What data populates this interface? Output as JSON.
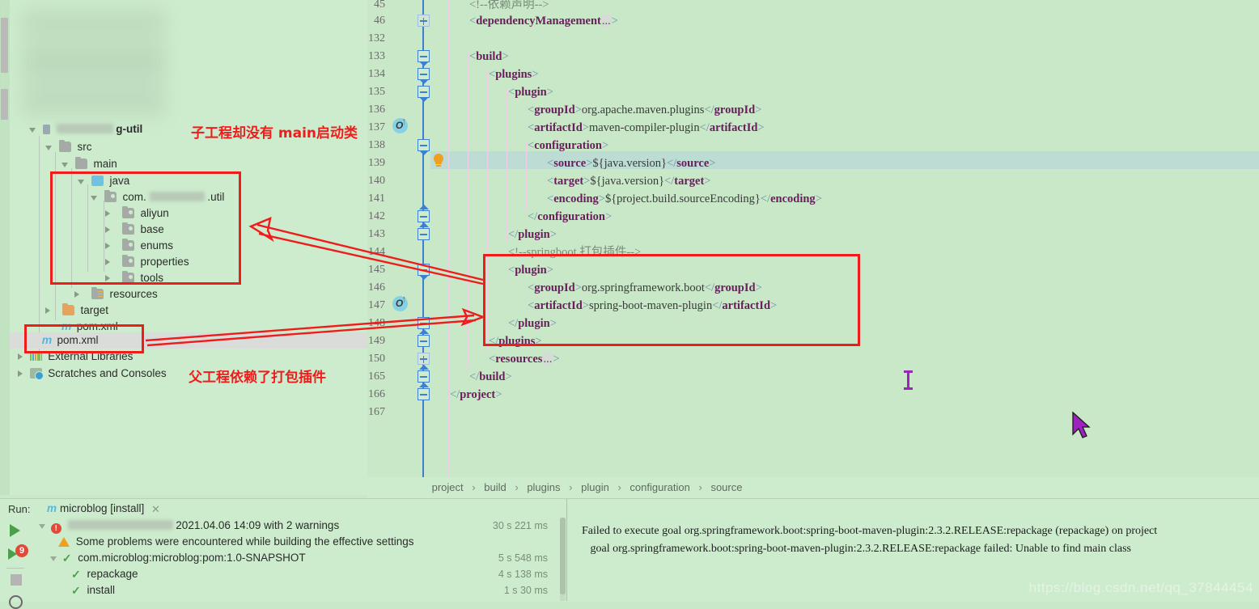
{
  "annotations": {
    "top_note": "子工程却没有 main启动类",
    "bottom_note": "父工程依赖了打包插件",
    "color": "#ef1c1c"
  },
  "project_tree": {
    "items": [
      {
        "label": "g-util",
        "type": "module",
        "icon": "module-icon",
        "blurred_prefix": true,
        "depth": 0,
        "expanded": true,
        "bold": true
      },
      {
        "label": "src",
        "type": "folder",
        "icon": "folder-icon",
        "depth": 1,
        "expanded": true
      },
      {
        "label": "main",
        "type": "folder",
        "icon": "folder-icon",
        "depth": 2,
        "expanded": true
      },
      {
        "label": "java",
        "type": "source-root",
        "icon": "source-root-icon",
        "depth": 3,
        "expanded": true
      },
      {
        "label": "com.",
        "label_suffix": ".util",
        "type": "package",
        "icon": "package-icon",
        "depth": 4,
        "expanded": true,
        "blurred_middle": true
      },
      {
        "label": "aliyun",
        "type": "package",
        "icon": "package-icon",
        "depth": 5,
        "expanded": false
      },
      {
        "label": "base",
        "type": "package",
        "icon": "package-icon",
        "depth": 5,
        "expanded": false
      },
      {
        "label": "enums",
        "type": "package",
        "icon": "package-icon",
        "depth": 5,
        "expanded": false
      },
      {
        "label": "properties",
        "type": "package",
        "icon": "package-icon",
        "depth": 5,
        "expanded": false
      },
      {
        "label": "tools",
        "type": "package",
        "icon": "package-icon",
        "depth": 5,
        "expanded": false
      },
      {
        "label": "resources",
        "type": "resources-root",
        "icon": "resources-icon",
        "depth": 3,
        "expanded": false
      },
      {
        "label": "target",
        "type": "folder",
        "icon": "folder-orange-icon",
        "depth": 2,
        "expanded": false
      },
      {
        "label": "pom.xml",
        "type": "file",
        "icon": "maven-icon",
        "depth": 2
      },
      {
        "label": "pom.xml",
        "type": "file",
        "icon": "maven-icon",
        "depth": 1,
        "selected": true
      },
      {
        "label": "External Libraries",
        "type": "node",
        "icon": "libraries-icon",
        "depth": 0,
        "expanded": false
      },
      {
        "label": "Scratches and Consoles",
        "type": "node",
        "icon": "scratches-icon",
        "depth": 0,
        "expanded": false
      }
    ]
  },
  "editor": {
    "lines": [
      {
        "num": "45",
        "indent": 2,
        "segments": [
          {
            "t": "<!--依赖声明-->",
            "c": "cm"
          }
        ]
      },
      {
        "num": "46",
        "indent": 2,
        "fold": "plus",
        "segments": [
          {
            "t": "<",
            "c": "br"
          },
          {
            "t": "dependencyManagement",
            "c": "tg"
          },
          {
            "t": "...",
            "c": "ph"
          },
          {
            "t": ">",
            "c": "br"
          }
        ]
      },
      {
        "num": "132",
        "indent": 0,
        "segments": []
      },
      {
        "num": "133",
        "indent": 2,
        "fold": "minus",
        "segments": [
          {
            "t": "<",
            "c": "br"
          },
          {
            "t": "build",
            "c": "tg"
          },
          {
            "t": ">",
            "c": "br"
          }
        ]
      },
      {
        "num": "134",
        "indent": 4,
        "fold": "minus",
        "segments": [
          {
            "t": "<",
            "c": "br"
          },
          {
            "t": "plugins",
            "c": "tg"
          },
          {
            "t": ">",
            "c": "br"
          }
        ]
      },
      {
        "num": "135",
        "indent": 6,
        "fold": "minus",
        "segments": [
          {
            "t": "<",
            "c": "br"
          },
          {
            "t": "plugin",
            "c": "tg"
          },
          {
            "t": ">",
            "c": "br"
          }
        ]
      },
      {
        "num": "136",
        "indent": 8,
        "segments": [
          {
            "t": "<",
            "c": "br"
          },
          {
            "t": "groupId",
            "c": "tg"
          },
          {
            "t": ">",
            "c": "br"
          },
          {
            "t": "org.apache.maven.plugins",
            "c": "v"
          },
          {
            "t": "</",
            "c": "br"
          },
          {
            "t": "groupId",
            "c": "tg"
          },
          {
            "t": ">",
            "c": "br"
          }
        ]
      },
      {
        "num": "137",
        "indent": 8,
        "overrides": true,
        "segments": [
          {
            "t": "<",
            "c": "br"
          },
          {
            "t": "artifactId",
            "c": "tg"
          },
          {
            "t": ">",
            "c": "br"
          },
          {
            "t": "maven-compiler-plugin",
            "c": "v"
          },
          {
            "t": "</",
            "c": "br"
          },
          {
            "t": "artifactId",
            "c": "tg"
          },
          {
            "t": ">",
            "c": "br"
          }
        ]
      },
      {
        "num": "138",
        "indent": 8,
        "fold": "minus",
        "segments": [
          {
            "t": "<",
            "c": "br"
          },
          {
            "t": "configuration",
            "c": "tg"
          },
          {
            "t": ">",
            "c": "br"
          }
        ]
      },
      {
        "num": "139",
        "indent": 10,
        "highlight": true,
        "bulb": true,
        "segments": [
          {
            "t": "<",
            "c": "br"
          },
          {
            "t": "source",
            "c": "tg"
          },
          {
            "t": ">",
            "c": "br"
          },
          {
            "t": "${java.version}",
            "c": "v"
          },
          {
            "t": "</",
            "c": "br"
          },
          {
            "t": "source",
            "c": "tg"
          },
          {
            "t": ">",
            "c": "br"
          }
        ]
      },
      {
        "num": "140",
        "indent": 10,
        "segments": [
          {
            "t": "<",
            "c": "br"
          },
          {
            "t": "target",
            "c": "tg"
          },
          {
            "t": ">",
            "c": "br"
          },
          {
            "t": "${java.version}",
            "c": "v"
          },
          {
            "t": "</",
            "c": "br"
          },
          {
            "t": "target",
            "c": "tg"
          },
          {
            "t": ">",
            "c": "br"
          }
        ]
      },
      {
        "num": "141",
        "indent": 10,
        "segments": [
          {
            "t": "<",
            "c": "br"
          },
          {
            "t": "encoding",
            "c": "tg"
          },
          {
            "t": ">",
            "c": "br"
          },
          {
            "t": "${project.build.sourceEncoding}",
            "c": "v"
          },
          {
            "t": "</",
            "c": "br"
          },
          {
            "t": "encoding",
            "c": "tg"
          },
          {
            "t": ">",
            "c": "br"
          }
        ]
      },
      {
        "num": "142",
        "indent": 8,
        "fold": "up",
        "segments": [
          {
            "t": "</",
            "c": "br"
          },
          {
            "t": "configuration",
            "c": "tg"
          },
          {
            "t": ">",
            "c": "br"
          }
        ]
      },
      {
        "num": "143",
        "indent": 6,
        "fold": "up",
        "segments": [
          {
            "t": "</",
            "c": "br"
          },
          {
            "t": "plugin",
            "c": "tg"
          },
          {
            "t": ">",
            "c": "br"
          }
        ]
      },
      {
        "num": "144",
        "indent": 6,
        "segments": [
          {
            "t": "<!--springboot 打包插件-->",
            "c": "cm"
          }
        ]
      },
      {
        "num": "145",
        "indent": 6,
        "fold": "minus",
        "segments": [
          {
            "t": "<",
            "c": "br"
          },
          {
            "t": "plugin",
            "c": "tg"
          },
          {
            "t": ">",
            "c": "br"
          }
        ]
      },
      {
        "num": "146",
        "indent": 8,
        "segments": [
          {
            "t": "<",
            "c": "br"
          },
          {
            "t": "groupId",
            "c": "tg"
          },
          {
            "t": ">",
            "c": "br"
          },
          {
            "t": "org.springframework.boot",
            "c": "v"
          },
          {
            "t": "</",
            "c": "br"
          },
          {
            "t": "groupId",
            "c": "tg"
          },
          {
            "t": ">",
            "c": "br"
          }
        ]
      },
      {
        "num": "147",
        "indent": 8,
        "overrides": true,
        "segments": [
          {
            "t": "<",
            "c": "br"
          },
          {
            "t": "artifactId",
            "c": "tg"
          },
          {
            "t": ">",
            "c": "br"
          },
          {
            "t": "spring-boot-maven-plugin",
            "c": "v"
          },
          {
            "t": "</",
            "c": "br"
          },
          {
            "t": "artifactId",
            "c": "tg"
          },
          {
            "t": ">",
            "c": "br"
          }
        ]
      },
      {
        "num": "148",
        "indent": 6,
        "fold": "updown",
        "segments": [
          {
            "t": "</",
            "c": "br"
          },
          {
            "t": "plugin",
            "c": "tg"
          },
          {
            "t": ">",
            "c": "br"
          }
        ]
      },
      {
        "num": "149",
        "indent": 4,
        "fold": "up",
        "segments": [
          {
            "t": "</",
            "c": "br"
          },
          {
            "t": "plugins",
            "c": "tg"
          },
          {
            "t": ">",
            "c": "br"
          }
        ]
      },
      {
        "num": "150",
        "indent": 4,
        "fold": "plus",
        "segments": [
          {
            "t": "<",
            "c": "br"
          },
          {
            "t": "resources",
            "c": "tg"
          },
          {
            "t": "...",
            "c": "ph"
          },
          {
            "t": ">",
            "c": "br"
          }
        ]
      },
      {
        "num": "165",
        "indent": 2,
        "fold": "up",
        "segments": [
          {
            "t": "</",
            "c": "br"
          },
          {
            "t": "build",
            "c": "tg"
          },
          {
            "t": ">",
            "c": "br"
          }
        ]
      },
      {
        "num": "166",
        "indent": 0,
        "fold": "up",
        "segments": [
          {
            "t": "</",
            "c": "br"
          },
          {
            "t": "project",
            "c": "tg"
          },
          {
            "t": ">",
            "c": "br"
          }
        ]
      },
      {
        "num": "167",
        "indent": 0,
        "segments": []
      }
    ]
  },
  "breadcrumb": {
    "items": [
      "project",
      "build",
      "plugins",
      "plugin",
      "configuration",
      "source"
    ],
    "separator": "›"
  },
  "run_panel": {
    "label": "Run:",
    "tab_title": "microblog [install]",
    "tab_icon": "maven-icon",
    "close_glyph": "✕",
    "toolbar": {
      "run_icon": "run-icon",
      "rerun_icon": "rerun-icon",
      "rerun_badge": "9",
      "stop_icon": "stop-icon",
      "settings_icon": "gear-icon"
    },
    "rows": [
      {
        "icon": "error-icon",
        "label": "2021.04.06 14:09 with 2 warnings",
        "blurred_prefix": true,
        "time": "30 s 221 ms",
        "depth": 0,
        "expanded": true
      },
      {
        "icon": "warning-icon",
        "label": "Some problems were encountered while building the effective settings",
        "time": "",
        "depth": 1
      },
      {
        "icon": "success-icon",
        "label": "com.microblog:microblog:pom:1.0-SNAPSHOT",
        "time": "5 s 548 ms",
        "depth": 1,
        "expanded": true
      },
      {
        "icon": "success-icon",
        "label": "repackage",
        "time": "4 s 138 ms",
        "depth": 2
      },
      {
        "icon": "success-icon",
        "label": "install",
        "time": "1 s 30 ms",
        "depth": 2
      }
    ]
  },
  "console": {
    "lines": [
      "Failed to execute goal org.springframework.boot:spring-boot-maven-plugin:2.3.2.RELEASE:repackage (repackage) on project",
      "   goal org.springframework.boot:spring-boot-maven-plugin:2.3.2.RELEASE:repackage failed: Unable to find main class"
    ],
    "watermark": "https://blog.csdn.net/qq_37844454"
  }
}
